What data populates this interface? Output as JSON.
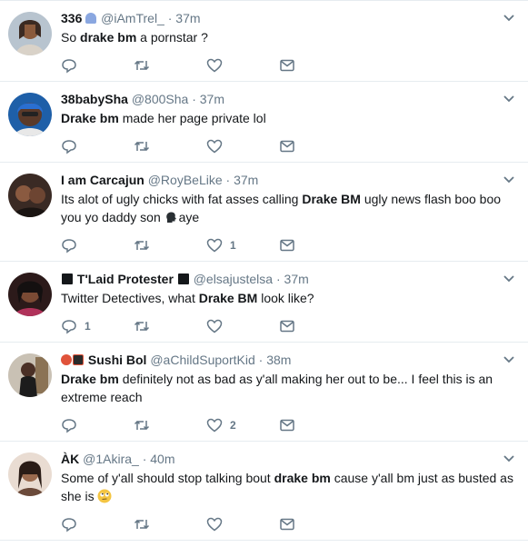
{
  "tweets": [
    {
      "name": "336",
      "handle": "@iAmTrel_",
      "time": "37m",
      "text_parts": [
        "So ",
        "drake bm",
        " a pornstar ?"
      ],
      "replies": "",
      "likes": ""
    },
    {
      "name": "38babySha",
      "handle": "@800Sha",
      "time": "37m",
      "text_parts": [
        "Drake bm",
        " made her page private lol"
      ],
      "replies": "",
      "likes": ""
    },
    {
      "name": "I am Carcajun",
      "handle": "@RoyBeLike",
      "time": "37m",
      "text_parts": [
        "Its alot of ugly chicks with fat asses calling ",
        "Drake BM",
        " ugly news flash boo boo you yo daddy son ",
        "aye"
      ],
      "replies": "",
      "likes": "1"
    },
    {
      "name": "T'Laid Protester",
      "handle": "@elsajustelsa",
      "time": "37m",
      "text_parts": [
        "Twitter Detectives, what ",
        "Drake BM",
        " look like?"
      ],
      "replies": "1",
      "likes": ""
    },
    {
      "name": "Sushi Bol",
      "handle": "@aChildSuportKid",
      "time": "38m",
      "text_parts": [
        "Drake bm",
        " definitely not as bad as y'all making her out to be... I feel this is an extreme reach"
      ],
      "replies": "",
      "likes": "2"
    },
    {
      "name": "ÀK",
      "handle": "@1Akira_",
      "time": "40m",
      "text_parts": [
        "Some of y'all should stop talking bout ",
        "drake bm",
        " cause y'all bm just as busted as she is"
      ],
      "replies": "",
      "likes": ""
    }
  ],
  "dot": "·",
  "icons": {
    "reply": "reply-icon",
    "retweet": "retweet-icon",
    "like": "heart-icon",
    "message": "direct-message-icon",
    "caret": "chevron-down-icon"
  },
  "colors": {
    "text": "#14171a",
    "muted": "#657786",
    "divider": "#e6ecf0",
    "badge": "#14171a"
  }
}
